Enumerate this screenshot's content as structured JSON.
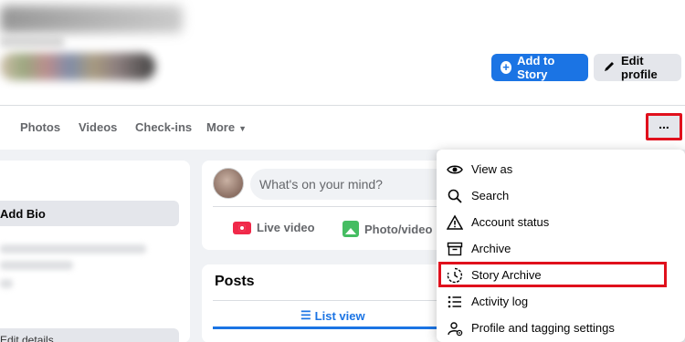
{
  "header": {
    "add_story_label": "Add to Story",
    "edit_profile_label": "Edit profile",
    "accent_color": "#1b74e4"
  },
  "nav": {
    "items": [
      "Photos",
      "Videos",
      "Check-ins",
      "More"
    ],
    "more_caret": "▼",
    "menu_button_label": "..."
  },
  "left": {
    "add_bio_label": "Add Bio",
    "edit_details_label": "Edit details"
  },
  "composer": {
    "placeholder": "What's on your mind?",
    "live_video_label": "Live video",
    "photo_video_label": "Photo/video"
  },
  "posts": {
    "title": "Posts",
    "list_view_label": "List view"
  },
  "menu": {
    "items": [
      {
        "label": "View as",
        "icon": "eye-icon"
      },
      {
        "label": "Search",
        "icon": "search-icon"
      },
      {
        "label": "Account status",
        "icon": "warning-icon"
      },
      {
        "label": "Archive",
        "icon": "archive-icon"
      },
      {
        "label": "Story Archive",
        "icon": "story-archive-icon"
      },
      {
        "label": "Activity log",
        "icon": "list-icon"
      },
      {
        "label": "Profile and tagging settings",
        "icon": "profile-gear-icon"
      }
    ],
    "highlight_color": "#e0101c"
  }
}
